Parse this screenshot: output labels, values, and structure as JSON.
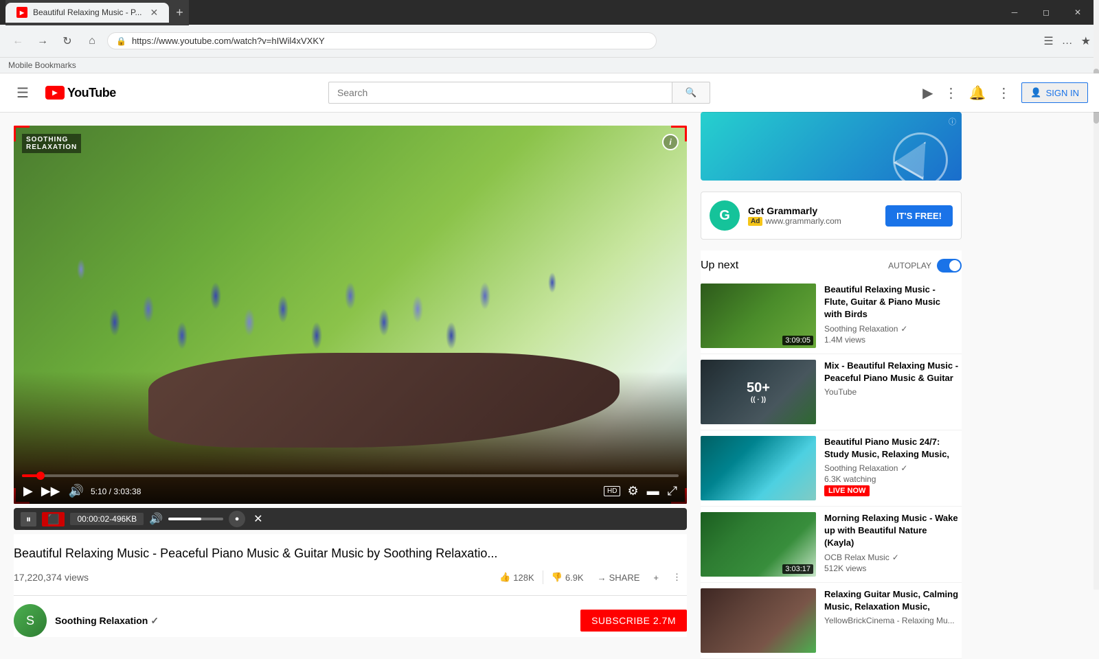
{
  "browser": {
    "tab_title": "Beautiful Relaxing Music - P...",
    "url": "https://www.youtube.com/watch?v=hIWil4xVXKY",
    "close_label": "✕",
    "new_tab_label": "+",
    "back_disabled": false,
    "forward_disabled": true,
    "bookmarks_label": "Mobile Bookmarks"
  },
  "youtube": {
    "logo_text": "YouTube",
    "search_placeholder": "Search",
    "sign_in_label": "SIGN IN"
  },
  "video": {
    "watermark": "SOOTHING\nRELAXATION",
    "current_time": "5:10",
    "total_time": "3:03:38",
    "title": "Beautiful Relaxing Music - Peaceful Piano Music & Guitar Music by Soothing Relaxatio...",
    "views": "17,220,374 views",
    "likes": "128K",
    "dislikes": "6.9K",
    "share_label": "SHARE",
    "add_label": "+",
    "channel_name": "Soothing Relaxation",
    "subscribe_label": "SUBSCRIBE 2.7M"
  },
  "media_bar": {
    "pause_label": "⏸",
    "stop_label": "⬛",
    "time_label": "00:00:02",
    "size_label": "496KB",
    "volume_icon": "🔊",
    "close_label": "✕"
  },
  "ad": {
    "badge": "ⓘ",
    "grammarly_title": "Get Grammarly",
    "grammarly_url": "www.grammarly.com",
    "ad_label": "Ad",
    "free_btn_label": "IT'S FREE!"
  },
  "up_next": {
    "title": "Up next",
    "autoplay_label": "AUTOPLAY",
    "items": [
      {
        "title": "Beautiful Relaxing Music - Flute, Guitar & Piano Music with Birds",
        "channel": "Soothing Relaxation",
        "verified": true,
        "meta": "1.4M views",
        "duration": "3:09:05",
        "thumb_class": "thumb-forest"
      },
      {
        "title": "Mix - Beautiful Relaxing Music - Peaceful Piano Music & Guitar",
        "channel": "YouTube",
        "verified": false,
        "meta": "",
        "duration": "50+",
        "is_mix": true,
        "thumb_class": "thumb-foggy"
      },
      {
        "title": "Beautiful Piano Music 24/7: Study Music, Relaxing Music,",
        "channel": "Soothing Relaxation",
        "verified": true,
        "meta": "6.3K watching",
        "is_live": true,
        "live_label": "LIVE NOW",
        "duration": "",
        "thumb_class": "thumb-waterfall"
      },
      {
        "title": "Morning Relaxing Music - Wake up with Beautiful Nature (Kayla)",
        "channel": "OCB Relax Music",
        "verified": true,
        "meta": "512K views",
        "duration": "3:03:17",
        "thumb_class": "thumb-nature"
      },
      {
        "title": "Relaxing Guitar Music, Calming Music, Relaxation Music,",
        "channel": "YellowBrickCinema - Relaxing Mu...",
        "verified": false,
        "meta": "",
        "duration": "",
        "thumb_class": "thumb-guitar"
      }
    ]
  }
}
